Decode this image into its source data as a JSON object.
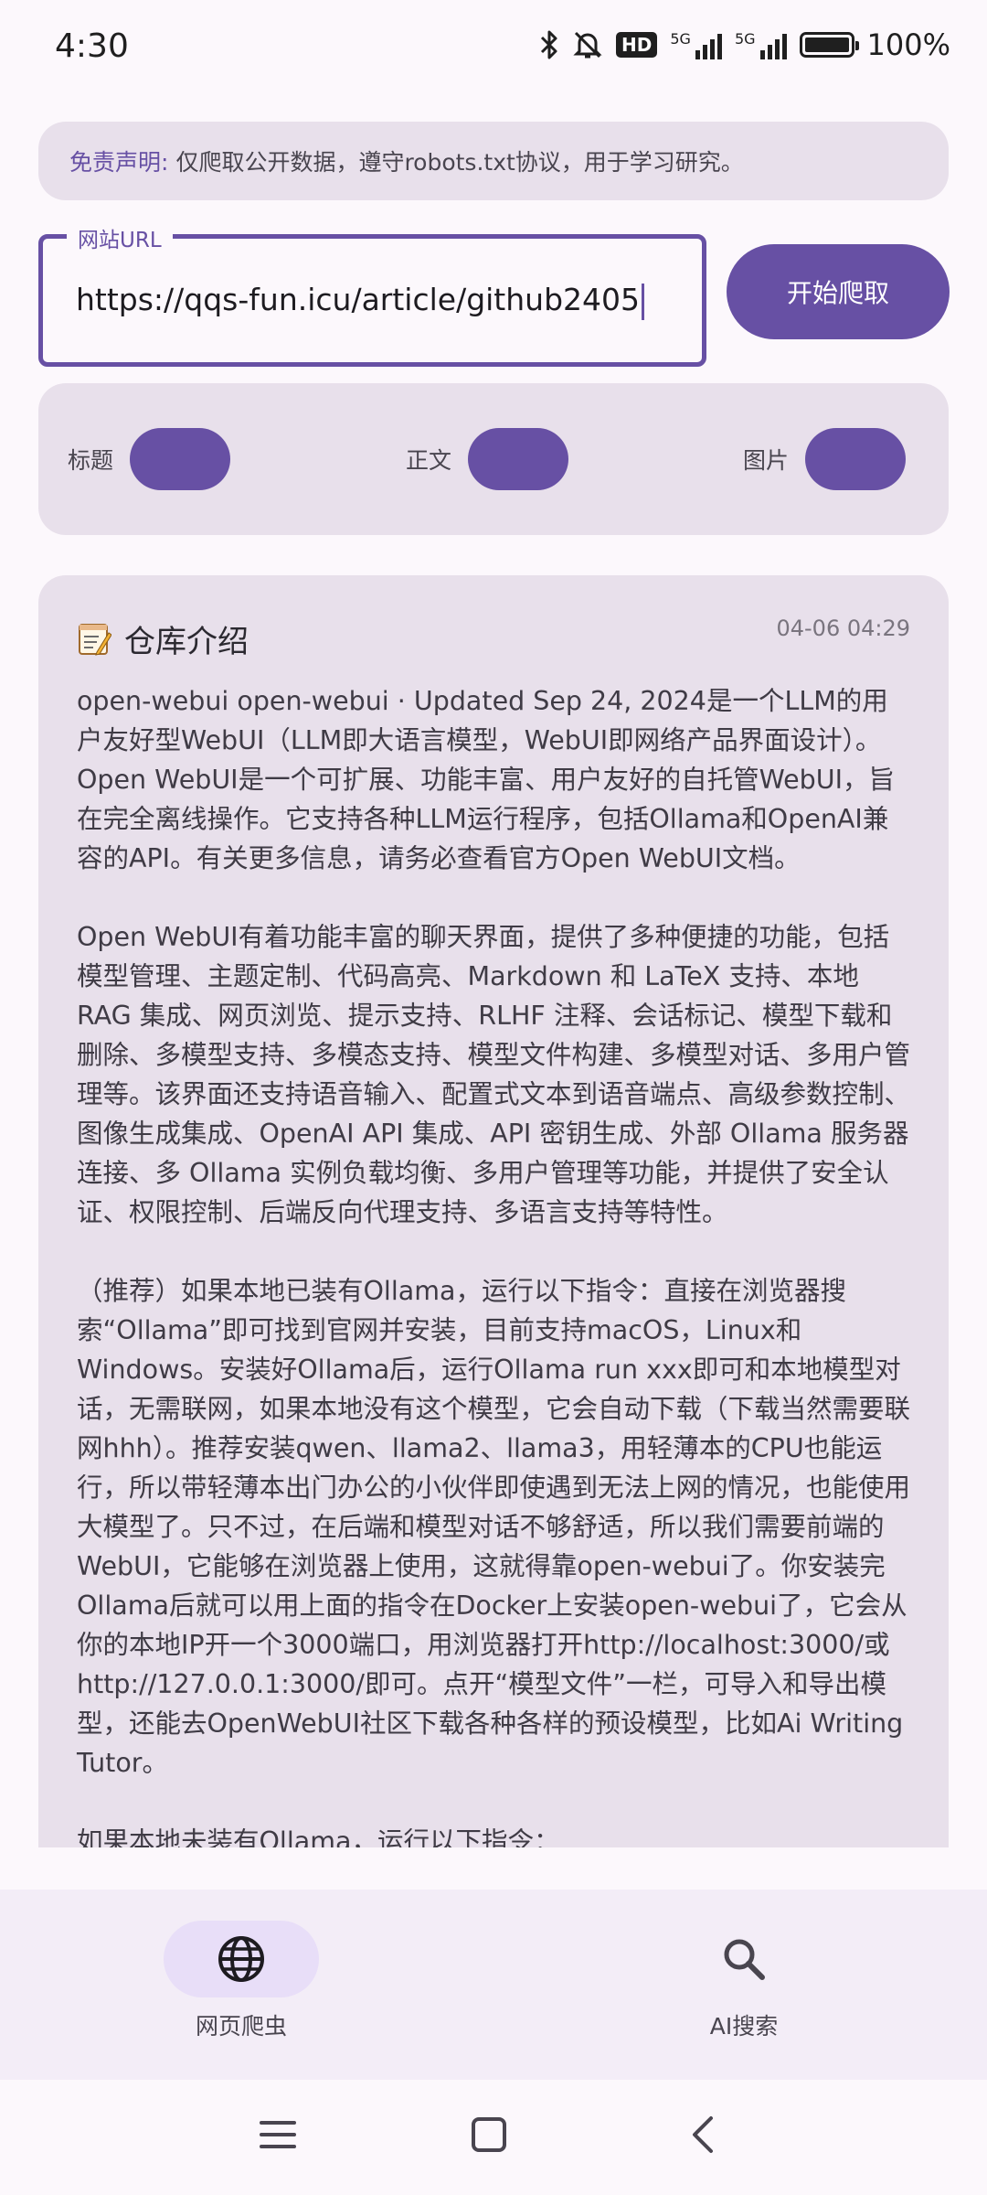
{
  "status": {
    "time": "4:30",
    "net1": "5G",
    "net2": "5G",
    "hd": "HD",
    "battery": "100%"
  },
  "disclaimer": {
    "label": "免责声明:",
    "text": "仅爬取公开数据，遵守robots.txt协议，用于学习研究。"
  },
  "url_field": {
    "label": "网站URL",
    "value": "https://qqs-fun.icu/article/github2405"
  },
  "start_button": "开始爬取",
  "options": [
    {
      "label": "标题",
      "on": true
    },
    {
      "label": "正文",
      "on": true
    },
    {
      "label": "图片",
      "on": true
    }
  ],
  "result": {
    "title": "仓库介绍",
    "timestamp": "04-06 04:29",
    "paragraphs": [
      "open-webui open-webui · Updated Sep 24, 2024是一个LLM的用户友好型WebUI（LLM即大语言模型，WebUI即网络产品界面设计）。Open WebUI是一个可扩展、功能丰富、用户友好的自托管WebUI，旨在完全离线操作。它支持各种LLM运行程序，包括Ollama和OpenAI兼容的API。有关更多信息，请务必查看官方Open WebUI文档。",
      "Open WebUI有着功能丰富的聊天界面，提供了多种便捷的功能，包括模型管理、主题定制、代码高亮、Markdown 和 LaTeX 支持、本地 RAG 集成、网页浏览、提示支持、RLHF 注释、会话标记、模型下载和删除、多模型支持、多模态支持、模型文件构建、多模型对话、多用户管理等。该界面还支持语音输入、配置式文本到语音端点、高级参数控制、图像生成集成、OpenAI API 集成、API 密钥生成、外部 Ollama 服务器连接、多 Ollama 实例负载均衡、多用户管理等功能，并提供了安全认证、权限控制、后端反向代理支持、多语言支持等特性。",
      "（推荐）如果本地已装有Ollama，运行以下指令：直接在浏览器搜索“Ollama”即可找到官网并安装，目前支持macOS，Linux和Windows。安装好Ollama后，运行Ollama run xxx即可和本地模型对话，无需联网，如果本地没有这个模型，它会自动下载（下载当然需要联网hhh）。推荐安装qwen、llama2、llama3，用轻薄本的CPU也能运行，所以带轻薄本出门办公的小伙伴即使遇到无法上网的情况，也能使用大模型了。只不过，在后端和模型对话不够舒适，所以我们需要前端的WebUI，它能够在浏览器上使用，这就得靠open-webui了。你安装完Ollama后就可以用上面的指令在Docker上安装open-webui了，它会从你的本地IP开一个3000端口，用浏览器打开http://localhost:3000/或http://127.0.0.1:3000/即可。点开“模型文件”一栏，可导入和导出模型，还能去OpenWebUI社区下载各种各样的预设模型，比如Ai Writing Tutor。",
      "如果本地未装有Ollama，运行以下指令："
    ]
  },
  "nav": [
    {
      "label": "网页爬虫",
      "icon": "globe-icon",
      "active": true
    },
    {
      "label": "AI搜索",
      "icon": "search-icon",
      "active": false
    }
  ],
  "colors": {
    "primary": "#6750A4",
    "surface": "#E8E0EB",
    "background": "#FCF8FC",
    "nav_background": "#F3EDF7",
    "active_indicator": "#E8DEF8"
  }
}
